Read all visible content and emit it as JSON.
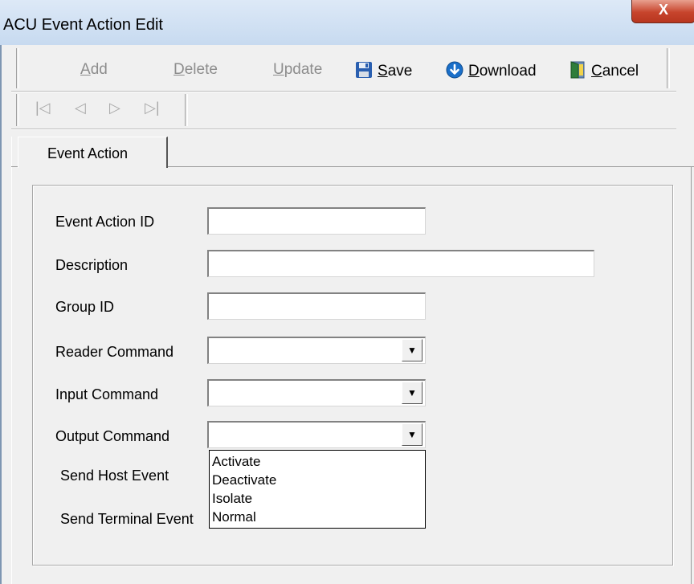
{
  "window": {
    "title": "ACU Event Action Edit",
    "close_glyph": "X"
  },
  "toolbar": {
    "add": {
      "u": "A",
      "rest": "dd"
    },
    "delete": {
      "u": "D",
      "rest": "elete"
    },
    "update": {
      "u": "U",
      "rest": "pdate"
    },
    "save": {
      "u": "S",
      "rest": "ave",
      "icon": "floppy-disk-icon"
    },
    "download": {
      "u": "D",
      "rest": "ownload",
      "icon": "download-arrow-icon"
    },
    "cancel": {
      "u": "C",
      "rest": "ancel",
      "icon": "door-exit-icon"
    }
  },
  "nav": {
    "first": "|◁",
    "prev": "◁",
    "next": "▷",
    "last": "▷|"
  },
  "tab": {
    "label": "Event Action"
  },
  "form": {
    "event_action_id": {
      "label": "Event Action ID",
      "value": ""
    },
    "description": {
      "label": "Description",
      "value": ""
    },
    "group_id": {
      "label": "Group ID",
      "value": ""
    },
    "reader_command": {
      "label": "Reader Command",
      "value": ""
    },
    "input_command": {
      "label": "Input Command",
      "value": ""
    },
    "output_command": {
      "label": "Output Command",
      "value": ""
    },
    "send_host_event": {
      "label": "Send Host Event"
    },
    "send_terminal_event": {
      "label": "Send Terminal Event"
    }
  },
  "output_dropdown": {
    "options": [
      "Activate",
      "Deactivate",
      "Isolate",
      "Normal"
    ]
  },
  "colors": {
    "title_bar": "#c7daf0",
    "close_button": "#c7442c",
    "download_icon": "#1a6fc9",
    "save_icon": "#2a5fb0"
  }
}
